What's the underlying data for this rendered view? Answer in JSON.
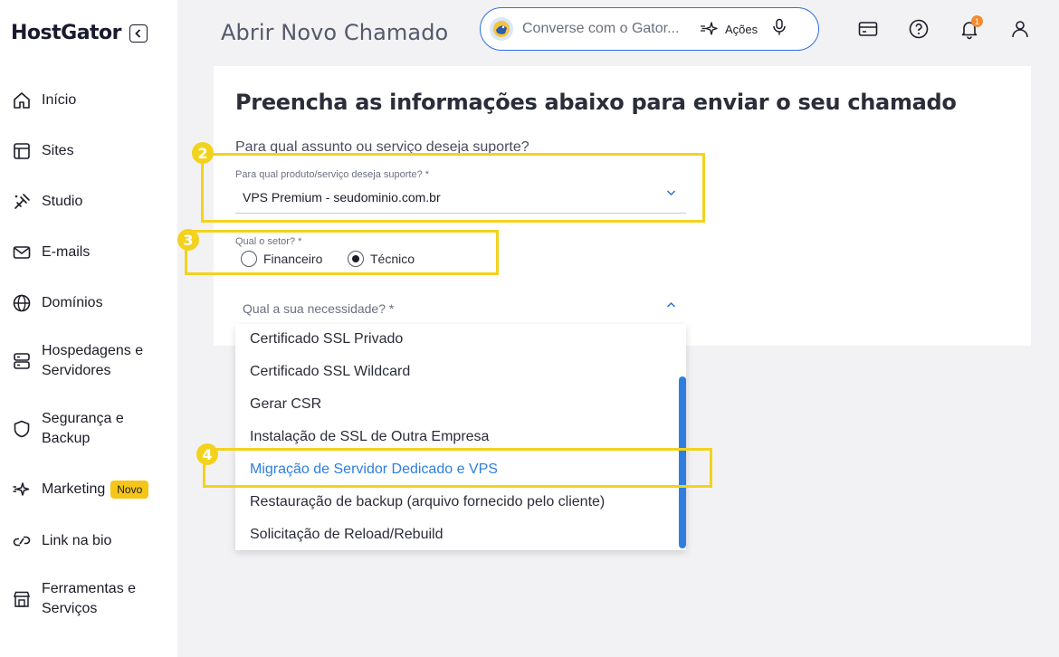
{
  "brand": {
    "logo_text": "HostGator"
  },
  "sidebar": {
    "items": [
      {
        "label": "Início",
        "icon": "home-icon"
      },
      {
        "label": "Sites",
        "icon": "layout-icon"
      },
      {
        "label": "Studio",
        "icon": "studio-icon"
      },
      {
        "label": "E-mails",
        "icon": "mail-icon"
      },
      {
        "label": "Domínios",
        "icon": "globe-icon"
      },
      {
        "label_line1": "Hospedagens e",
        "label_line2": "Servidores",
        "icon": "server-icon"
      },
      {
        "label_line1": "Segurança e",
        "label_line2": "Backup",
        "icon": "shield-icon"
      },
      {
        "label": "Marketing",
        "badge": "Novo",
        "icon": "sparkle-icon"
      },
      {
        "label": "Link na bio",
        "icon": "link-icon"
      },
      {
        "label_line1": "Ferramentas e",
        "label_line2": "Serviços",
        "icon": "store-icon"
      }
    ]
  },
  "header": {
    "title": "Abrir Novo Chamado",
    "search_placeholder": "Converse com o Gator...",
    "actions_label": "Ações",
    "notification_count": "1"
  },
  "form": {
    "heading": "Preencha as informações abaixo para enviar o seu chamado",
    "subject_question": "Para qual assunto ou serviço deseja suporte?",
    "product_label": "Para qual produto/serviço deseja suporte? *",
    "product_value": "VPS Premium - seudominio.com.br",
    "sector_label": "Qual o setor? *",
    "sector_options": [
      "Financeiro",
      "Técnico"
    ],
    "sector_selected": "Técnico",
    "need_label": "Qual a sua necessidade? *",
    "need_options": [
      "Certificado SSL Privado",
      "Certificado SSL Wildcard",
      "Gerar CSR",
      "Instalação de SSL de Outra Empresa",
      "Migração de Servidor Dedicado e VPS",
      "Restauração de backup (arquivo fornecido pelo cliente)",
      "Solicitação de Reload/Rebuild"
    ],
    "need_highlighted": "Migração de Servidor Dedicado e VPS"
  },
  "annotations": {
    "step2": "2",
    "step3": "3",
    "step4": "4"
  },
  "colors": {
    "highlight": "#f3d21d",
    "accent": "#2e7ee0",
    "badge": "#f5c518"
  }
}
